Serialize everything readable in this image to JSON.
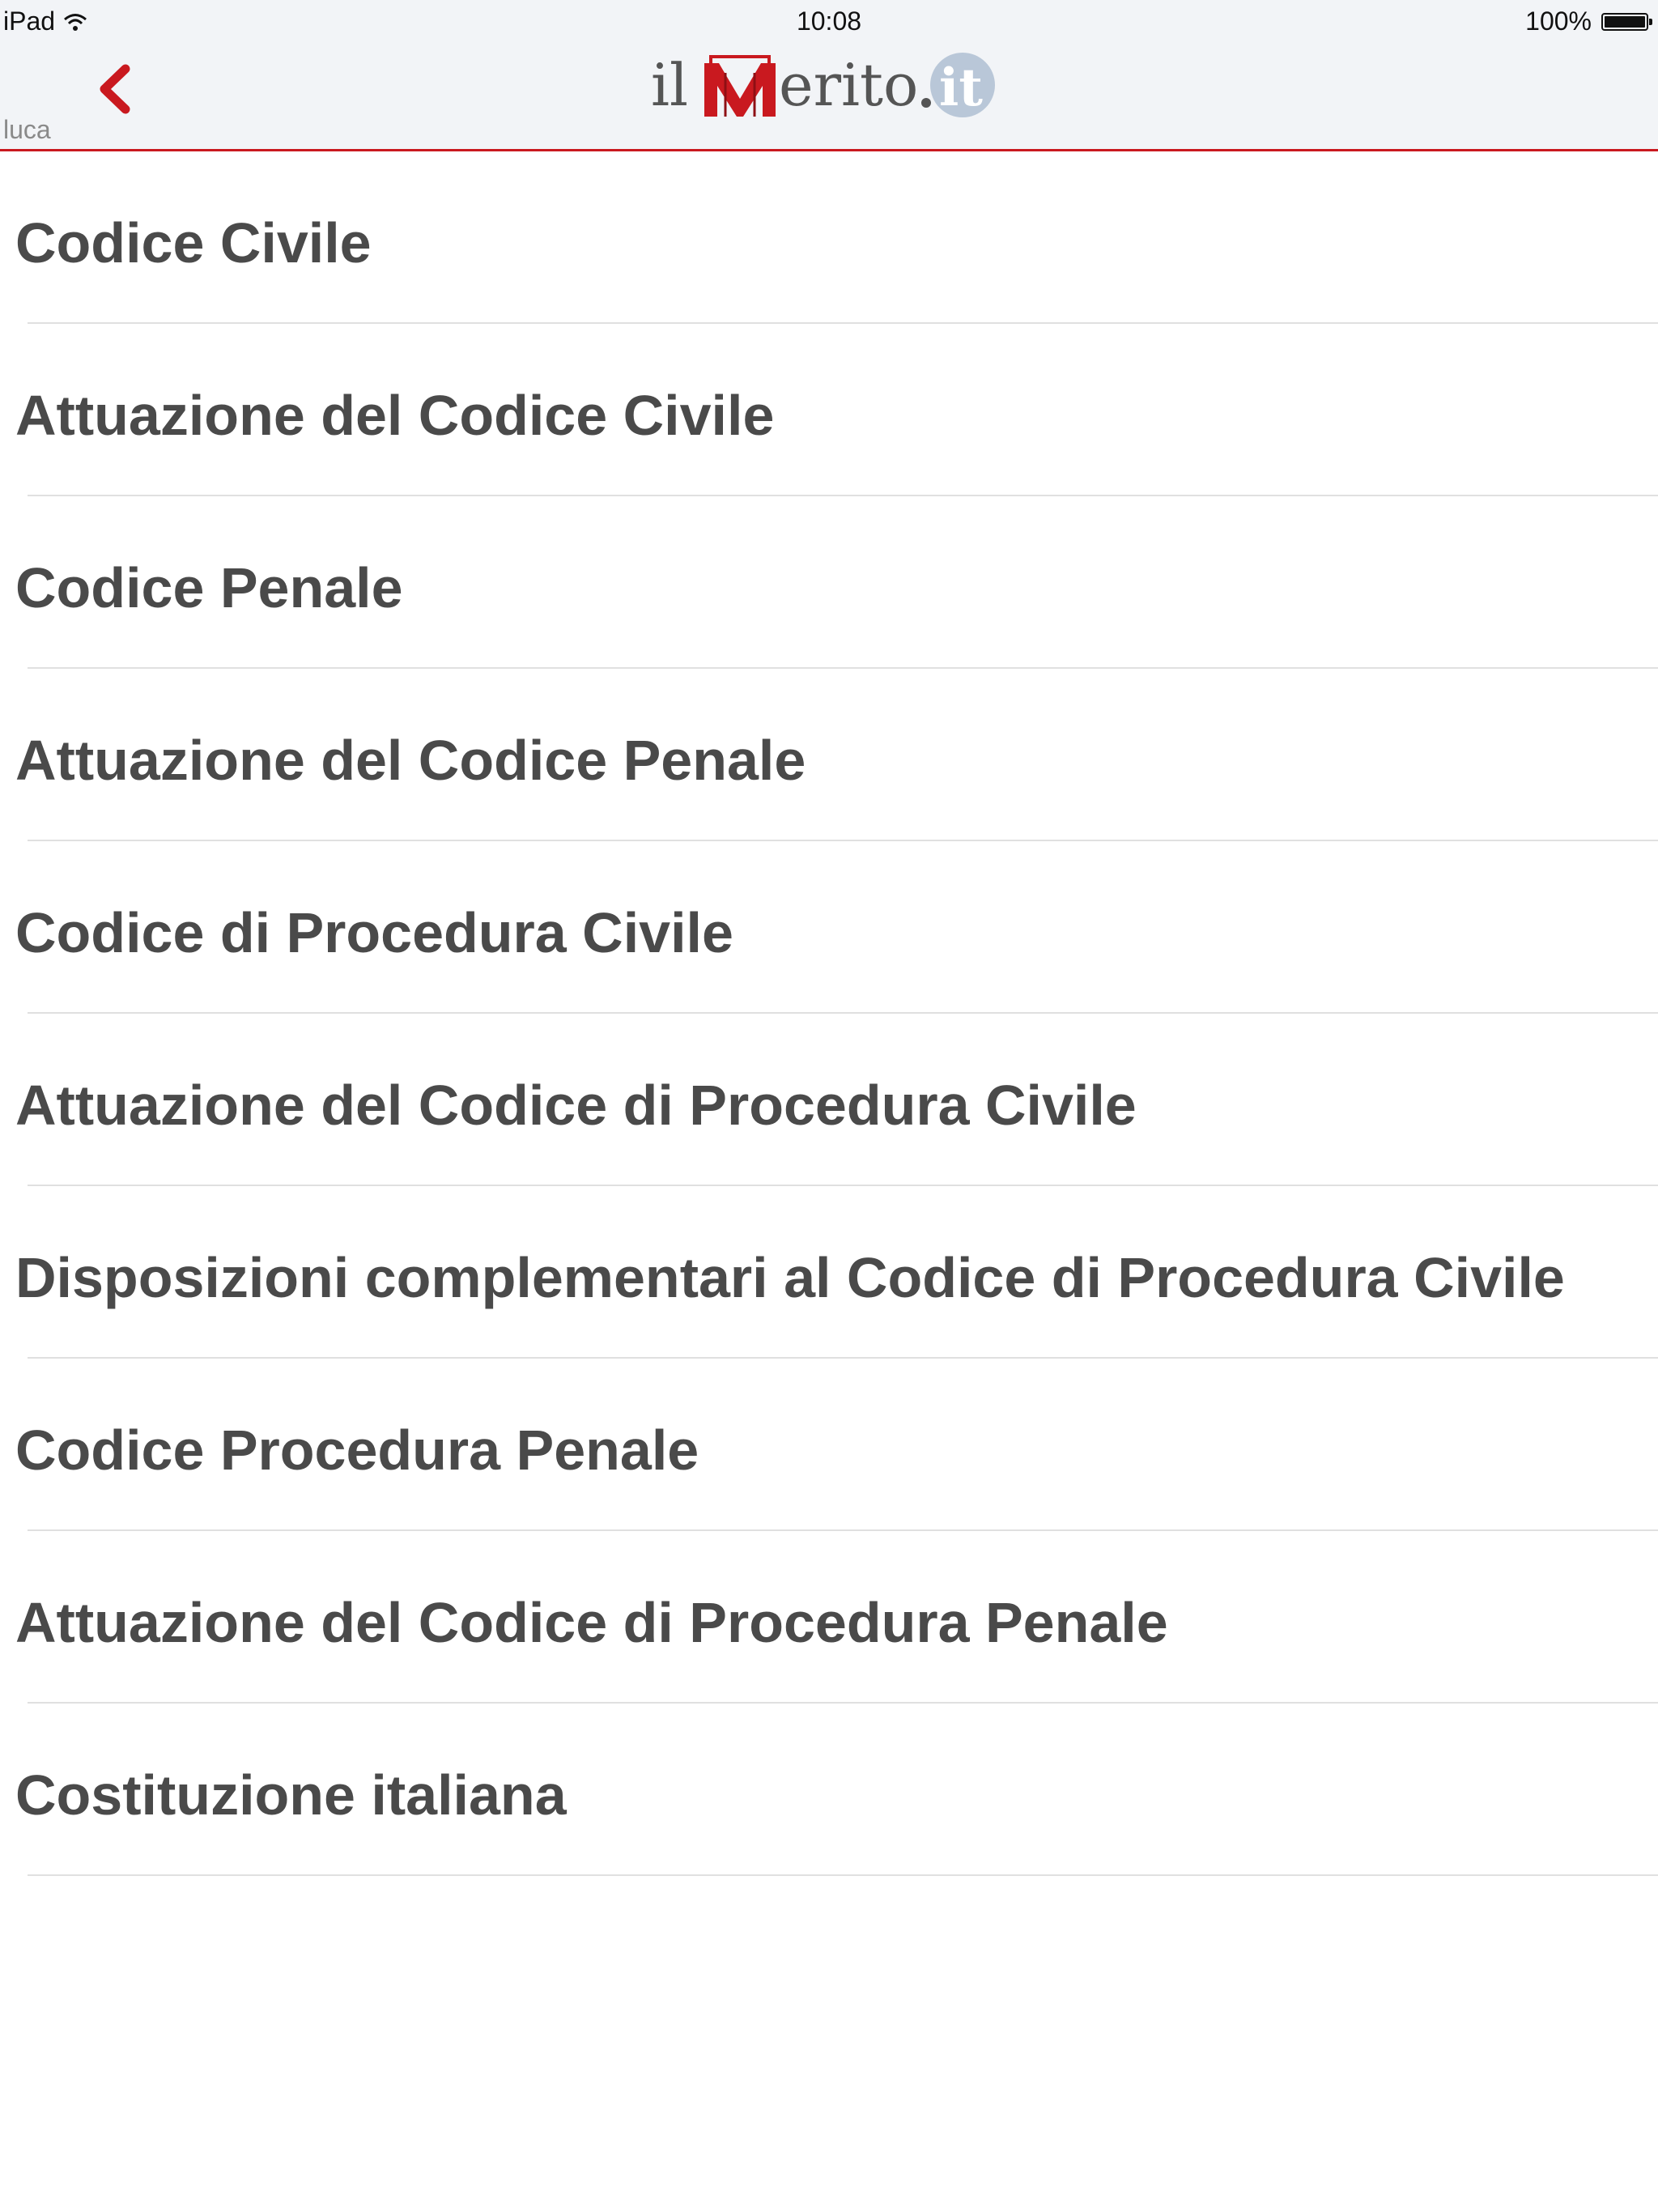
{
  "status_bar": {
    "device": "iPad",
    "time": "10:08",
    "battery": "100%"
  },
  "nav": {
    "user": "luca",
    "logo_text": "ilMerito.it",
    "accent_color": "#c9191f"
  },
  "list": {
    "items": [
      {
        "label": "Codice Civile"
      },
      {
        "label": "Attuazione del Codice Civile"
      },
      {
        "label": "Codice Penale"
      },
      {
        "label": "Attuazione del Codice Penale"
      },
      {
        "label": "Codice di Procedura Civile"
      },
      {
        "label": "Attuazione del Codice di Procedura Civile"
      },
      {
        "label": "Disposizioni complementari al Codice di Procedura Civile"
      },
      {
        "label": "Codice Procedura Penale"
      },
      {
        "label": "Attuazione del Codice di Procedura Penale"
      },
      {
        "label": "Costituzione italiana"
      }
    ]
  }
}
